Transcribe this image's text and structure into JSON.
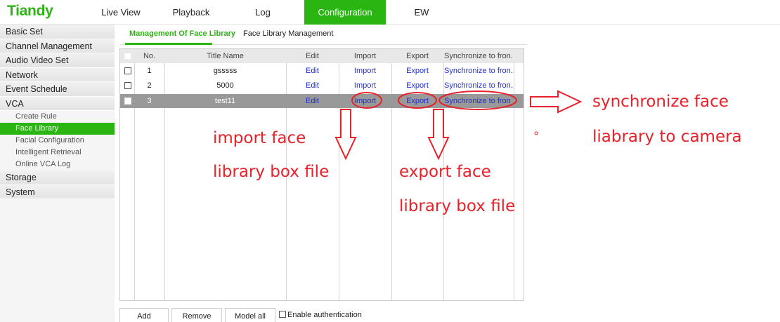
{
  "app": {
    "logo": "Tiandy"
  },
  "nav": [
    {
      "label": "Live View"
    },
    {
      "label": "Playback"
    },
    {
      "label": "Log"
    },
    {
      "label": "Configuration"
    },
    {
      "label": "EW"
    }
  ],
  "sidebar": {
    "groups": [
      {
        "label": "Basic Set"
      },
      {
        "label": "Channel Management"
      },
      {
        "label": "Audio Video Set"
      },
      {
        "label": "Network"
      },
      {
        "label": "Event Schedule"
      },
      {
        "label": "VCA"
      }
    ],
    "vca_items": [
      {
        "label": "Create Rule"
      },
      {
        "label": "Face Library"
      },
      {
        "label": "Facial Configuration"
      },
      {
        "label": "Intelligent Retrieval"
      },
      {
        "label": "Online VCA Log"
      }
    ],
    "tail_groups": [
      {
        "label": "Storage"
      },
      {
        "label": "System"
      }
    ]
  },
  "tabs": [
    {
      "label": "Management Of Face Library"
    },
    {
      "label": "Face Library Management"
    }
  ],
  "table": {
    "headers": {
      "no": "No.",
      "title": "Title Name",
      "edit": "Edit",
      "import": "Import",
      "export": "Export",
      "sync": "Synchronize to fron..."
    },
    "rows": [
      {
        "no": "1",
        "title": "gsssss",
        "edit": "Edit",
        "import": "Import",
        "export": "Export",
        "sync": "Synchronize to fron..."
      },
      {
        "no": "2",
        "title": "5000",
        "edit": "Edit",
        "import": "Import",
        "export": "Export",
        "sync": "Synchronize to fron..."
      },
      {
        "no": "3",
        "title": "test11",
        "edit": "Edit",
        "import": "Import",
        "export": "Export",
        "sync": "Synchronize to fron"
      }
    ]
  },
  "buttons": {
    "add": "Add",
    "remove": "Remove",
    "model_all": "Model all",
    "enable_auth": "Enable authentication"
  },
  "annotations": {
    "import_line1": "import face",
    "import_line2": "library box file",
    "export_line1": "export face",
    "export_line2": "library box file",
    "sync_line1": "synchronize face",
    "sync_line2": "liabrary to camera",
    "color": "#e8212a"
  },
  "colors": {
    "accent": "#2bb513",
    "link": "#1f2ee0",
    "selected_row": "#999999"
  }
}
